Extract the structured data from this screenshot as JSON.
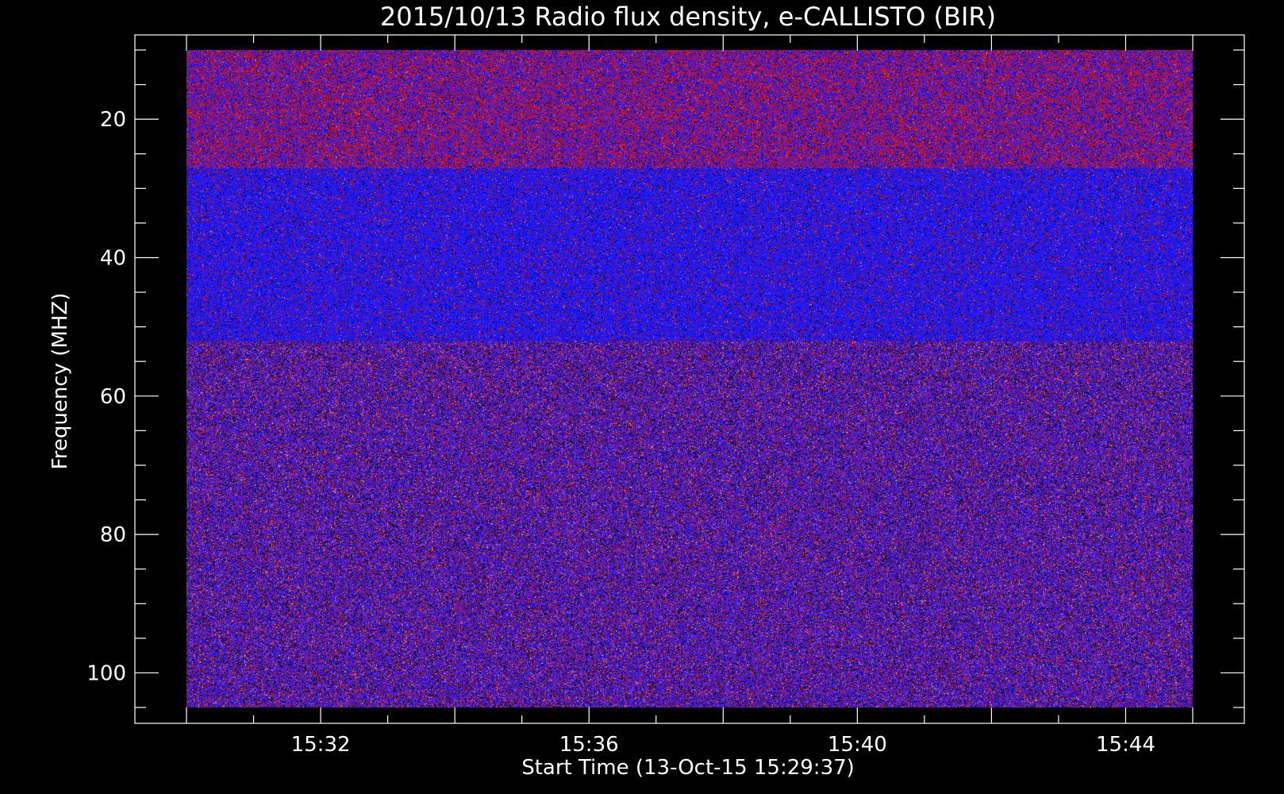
{
  "chart_data": {
    "type": "heatmap",
    "title": "2015/10/13  Radio flux density, e-CALLISTO (BIR)",
    "xlabel": "Start Time (13-Oct-15 15:29:37)",
    "ylabel": "Frequency (MHZ)",
    "x_axis": {
      "kind": "time",
      "range": [
        "15:29:37",
        "15:45:00"
      ],
      "major_ticks": [
        "15:30",
        "15:32",
        "15:34",
        "15:36",
        "15:38",
        "15:40",
        "15:42",
        "15:44",
        "15:45"
      ],
      "tick_labels": [
        "15:32",
        "15:36",
        "15:40",
        "15:44"
      ],
      "minor_ticks": [
        "15:31",
        "15:33",
        "15:35",
        "15:37",
        "15:39",
        "15:41",
        "15:43"
      ]
    },
    "y_axis": {
      "range": [
        10,
        108
      ],
      "inverted": true,
      "data_range": [
        10,
        105
      ],
      "major_ticks": [
        20,
        40,
        60,
        80,
        100
      ],
      "tick_labels": [
        "20",
        "40",
        "60",
        "80",
        "100"
      ],
      "minor_ticks": [
        10,
        15,
        25,
        30,
        35,
        45,
        50,
        55,
        65,
        70,
        75,
        85,
        90,
        95,
        105
      ]
    },
    "bands": [
      {
        "from_mhz": 10,
        "to_mhz": 27,
        "dominant": "red-blue noise"
      },
      {
        "from_mhz": 27,
        "to_mhz": 52,
        "dominant": "blue"
      },
      {
        "from_mhz": 52,
        "to_mhz": 105,
        "dominant": "purple with orange speckle"
      }
    ],
    "colors": {
      "background": "#000000",
      "foreground": "#ffffff",
      "red": "#d81818",
      "blue": "#1818ff",
      "purple": "#5a20c8",
      "orange": "#ffa050"
    },
    "grid": false,
    "legend": "none"
  }
}
